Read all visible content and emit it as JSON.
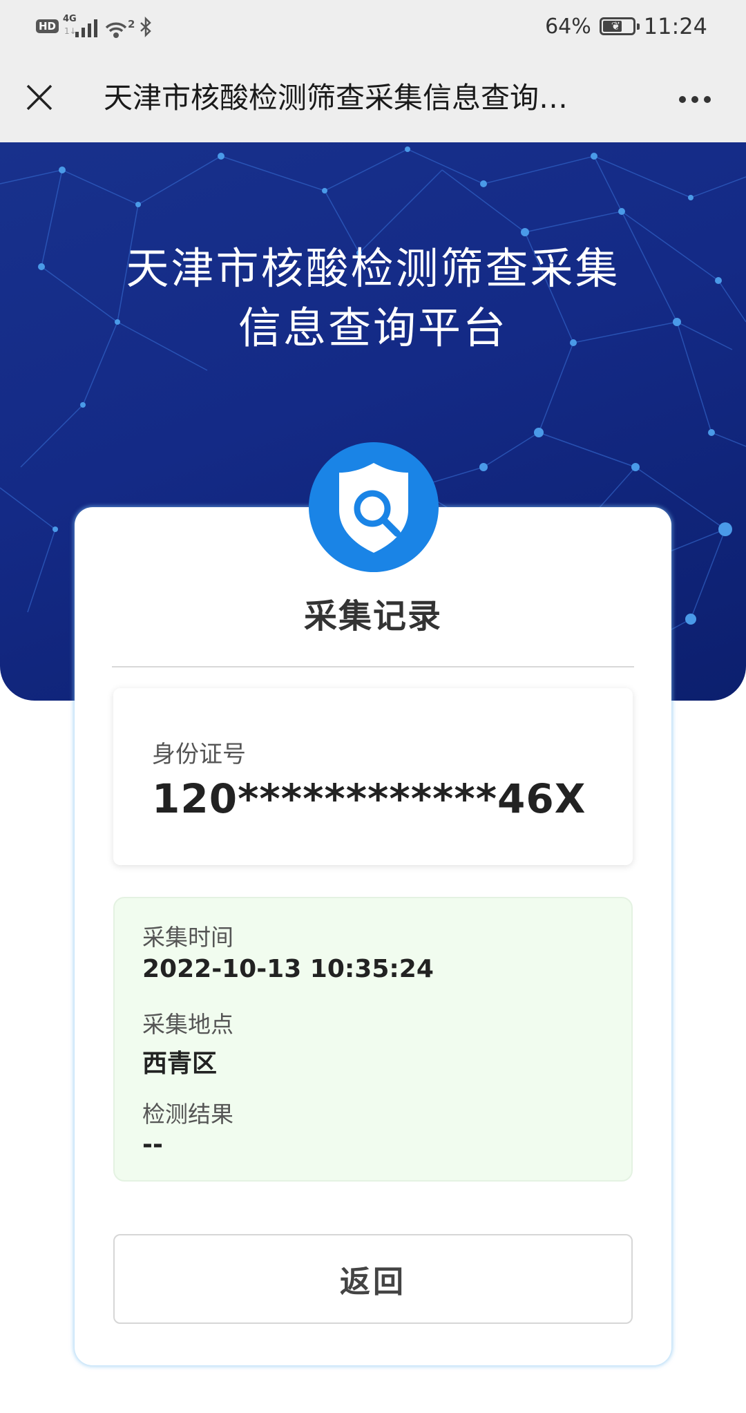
{
  "status_bar": {
    "hd": "HD",
    "network": "4G",
    "wifi_sup": "2",
    "battery_text": "64%",
    "battery_level": 0.64,
    "time": "11:24"
  },
  "nav": {
    "title": "天津市核酸检测筛查采集信息查询…"
  },
  "banner": {
    "title_line1": "天津市核酸检测筛查采集",
    "title_line2": "信息查询平台"
  },
  "card": {
    "title": "采集记录",
    "id_label": "身份证号",
    "id_value": "120************46X",
    "fields": [
      {
        "label": "采集时间",
        "value": "2022-10-13 10:35:24"
      },
      {
        "label": "采集地点",
        "value": "西青区"
      },
      {
        "label": "检测结果",
        "value": "--"
      }
    ],
    "back_label": "返回"
  },
  "colors": {
    "banner_blue": "#142a86",
    "badge_blue": "#1a84e6",
    "info_green_bg": "#f1fcef"
  }
}
